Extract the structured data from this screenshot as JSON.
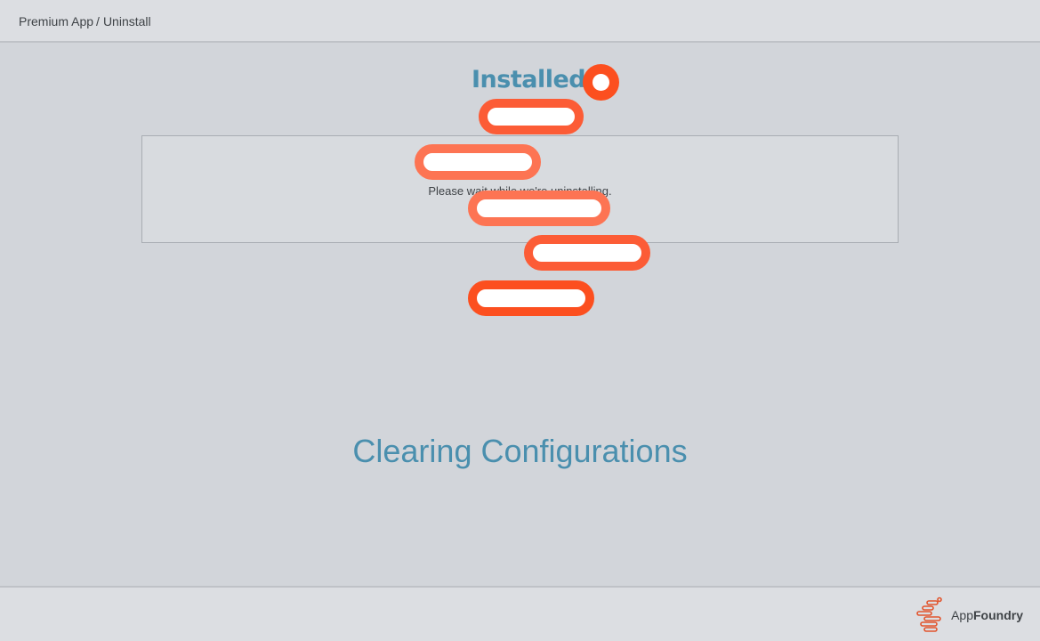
{
  "breadcrumb": {
    "parent": "Premium App",
    "separator": "/",
    "current": "Uninstall"
  },
  "status": {
    "installed_label": "Installed",
    "wait_message": "Please wait while we're uninstalling.",
    "step_label": "Clearing Configurations"
  },
  "footer": {
    "brand_light": "App",
    "brand_bold": "Foundry"
  },
  "colors": {
    "accent": "#4a8fae",
    "brand_orange": "#fc4f1f",
    "pill_orange": "#fc5c36",
    "background": "#d2d5da",
    "bar": "#dcdee2"
  },
  "icons": {
    "loader": "orange-ring-and-pill-animation",
    "brand": "appfoundry-logo-icon"
  }
}
